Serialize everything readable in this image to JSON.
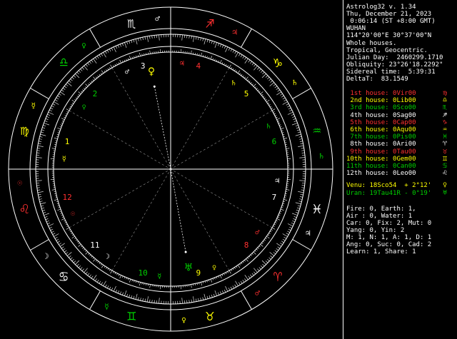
{
  "info": {
    "title": "Astrolog32 v. 1.34",
    "date": "Thu, December 21, 2023",
    "time": " 0:06:14 (ST +8:00 GMT)",
    "place": "WUHAN",
    "coords": "114°20'00\"E 30°37'00\"N",
    "houses_system": "Whole houses.",
    "zodiac": "Tropical, Geocentric.",
    "julian": "Julian Day:  2460299.1710",
    "obliquity": "Obliquity: 23°26'18.2292\"",
    "sidereal": "Sidereal time:  5:39:31",
    "deltat": "DeltaT:  83.1549"
  },
  "houses": [
    {
      "name": "1st house:",
      "value": "0Vir00",
      "color": "#ff3030",
      "sign": "♍"
    },
    {
      "name": "2nd house:",
      "value": "0Lib00",
      "color": "#ffff00",
      "sign": "♎"
    },
    {
      "name": "3rd house:",
      "value": "0Sco00",
      "color": "#00d000",
      "sign": "♏"
    },
    {
      "name": "4th house:",
      "value": "0Sag00",
      "color": "#ffffff",
      "sign": "♐"
    },
    {
      "name": "5th house:",
      "value": "0Cap00",
      "color": "#ff3030",
      "sign": "♑"
    },
    {
      "name": "6th house:",
      "value": "0Aqu00",
      "color": "#ffff00",
      "sign": "♒"
    },
    {
      "name": "7th house:",
      "value": "0Pis00",
      "color": "#00d000",
      "sign": "♓"
    },
    {
      "name": "8th house:",
      "value": "0Ari00",
      "color": "#ffffff",
      "sign": "♈"
    },
    {
      "name": "9th house:",
      "value": "0Tau00",
      "color": "#ff3030",
      "sign": "♉"
    },
    {
      "name": "10th house:",
      "value": "0Gem00",
      "color": "#ffff00",
      "sign": "♊"
    },
    {
      "name": "11th house:",
      "value": "0Can00",
      "color": "#00d000",
      "sign": "♋"
    },
    {
      "name": "12th house:",
      "value": "0Leo00",
      "color": "#ffffff",
      "sign": "♌"
    }
  ],
  "planets": [
    {
      "label": "Venu: 18Sco54  + 2°12'",
      "color": "#ffff00",
      "glyph": "♀"
    },
    {
      "label": "Uran: 19Tau41R - 0°19'",
      "color": "#00d000",
      "glyph": "♅"
    }
  ],
  "summary": [
    "Fire: 0, Earth: 1,",
    "Air : 0, Water: 1",
    "Car: 0, Fix: 2, Mut: 0",
    "Yang: 0, Yin: 2",
    "M: 1, N: 1, A: 1, D: 1",
    "Ang: 0, Suc: 0, Cad: 2",
    "Learn: 1, Share: 1"
  ],
  "wheel": {
    "house_numbers": [
      "1",
      "2",
      "3",
      "4",
      "5",
      "6",
      "7",
      "8",
      "9",
      "10",
      "11",
      "12"
    ],
    "sign_glyphs": [
      "♈",
      "♉",
      "♊",
      "♋",
      "♌",
      "♍",
      "♎",
      "♏",
      "♐",
      "♑",
      "♒",
      "♓"
    ],
    "ruler_glyphs": [
      "♂",
      "♀",
      "☿",
      "☽",
      "☉",
      "☿",
      "♀",
      "♂",
      "♃",
      "♄",
      "♄",
      "♃"
    ],
    "venus_glyph": "♀",
    "uranus_glyph": "♅",
    "colors": {
      "fire": "#ff3030",
      "earth": "#ffff00",
      "air": "#00d000",
      "water": "#ffffff"
    }
  }
}
